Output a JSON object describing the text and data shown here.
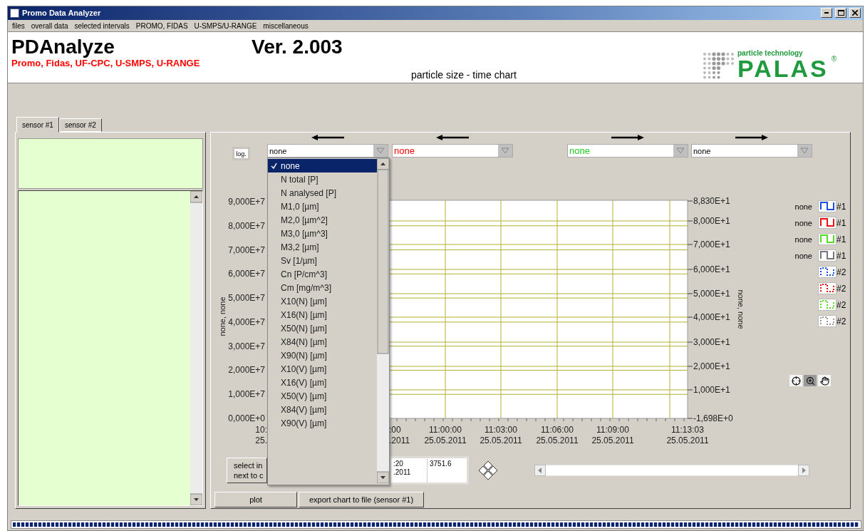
{
  "window": {
    "title": "Promo Data Analyzer"
  },
  "menu": [
    "files",
    "overall data",
    "selected intervals",
    "PROMO, FIDAS",
    "U-SMPS/U-RANGE",
    "miscellaneous"
  ],
  "header": {
    "app_name": "PDAnalyze",
    "devices": "Promo, Fidas, UF-CPC, U-SMPS, U-RANGE",
    "version": "Ver. 2.003",
    "chart_title": "particle size - time chart",
    "logo_tagline": "particle technology",
    "logo_name": "PALAS",
    "logo_mark": "®"
  },
  "tabs": [
    {
      "label": "sensor #1",
      "selected": true
    },
    {
      "label": "sensor #2",
      "selected": false
    }
  ],
  "log_button": "log.",
  "selectors": [
    {
      "value": "none",
      "color": "#000000",
      "kind": "left"
    },
    {
      "value": "none",
      "color": "#ff0000",
      "kind": "left"
    },
    {
      "value": "none",
      "color": "#22cc22",
      "kind": "right"
    },
    {
      "value": "none",
      "color": "#000000",
      "kind": "right"
    }
  ],
  "dropdown": {
    "items": [
      {
        "label": "none",
        "selected": true
      },
      {
        "label": "N total [P]",
        "selected": false
      },
      {
        "label": "N analysed [P]",
        "selected": false
      },
      {
        "label": "M1,0 [µm]",
        "selected": false
      },
      {
        "label": "M2,0 [µm^2]",
        "selected": false
      },
      {
        "label": "M3,0 [µm^3]",
        "selected": false
      },
      {
        "label": "M3,2 [µm]",
        "selected": false
      },
      {
        "label": "Sv [1/µm]",
        "selected": false
      },
      {
        "label": "Cn [P/cm^3]",
        "selected": false
      },
      {
        "label": "Cm [mg/m^3]",
        "selected": false
      },
      {
        "label": "X10(N) [µm]",
        "selected": false
      },
      {
        "label": "X16(N) [µm]",
        "selected": false
      },
      {
        "label": "X50(N) [µm]",
        "selected": false
      },
      {
        "label": "X84(N) [µm]",
        "selected": false
      },
      {
        "label": "X90(N) [µm]",
        "selected": false
      },
      {
        "label": "X10(V) [µm]",
        "selected": false
      },
      {
        "label": "X16(V) [µm]",
        "selected": false
      },
      {
        "label": "X50(V) [µm]",
        "selected": false
      },
      {
        "label": "X84(V) [µm]",
        "selected": false
      },
      {
        "label": "X90(V) [µm]",
        "selected": false
      }
    ]
  },
  "chart": {
    "y_left_title": "none, none",
    "y_right_title": "none, none",
    "y_left_ticks": [
      "9,000E+7",
      "8,000E+7",
      "7,000E+7",
      "6,000E+7",
      "5,000E+7",
      "4,000E+7",
      "3,000E+7",
      "2,000E+7",
      "1,000E+7",
      "0,000E+0"
    ],
    "y_right_ticks": [
      "8,830E+1",
      "8,000E+1",
      "7,000E+1",
      "6,000E+1",
      "5,000E+1",
      "4,000E+1",
      "3,000E+1",
      "2,000E+1",
      "1,000E+1",
      "-1,698E+0"
    ],
    "x_ticks": [
      {
        "time": "10:",
        "date": "25."
      },
      {
        "time": ":00",
        "date": ".2011"
      },
      {
        "time": "11:00:00",
        "date": "25.05.2011"
      },
      {
        "time": "11:03:00",
        "date": "25.05.2011"
      },
      {
        "time": "11:06:00",
        "date": "25.05.2011"
      },
      {
        "time": "11:09:00",
        "date": "25.05.2011"
      },
      {
        "time": "11:13:03",
        "date": "25.05.2011"
      }
    ]
  },
  "legend": [
    {
      "label": "none",
      "sensor": "#1",
      "color": "#1a4fe0",
      "kind": "solid"
    },
    {
      "label": "none",
      "sensor": "#1",
      "color": "#ee1111",
      "kind": "solid"
    },
    {
      "label": "none",
      "sensor": "#1",
      "color": "#55dd22",
      "kind": "solid"
    },
    {
      "label": "none",
      "sensor": "#1",
      "color": "#777777",
      "kind": "solid"
    },
    {
      "sensor": "#2",
      "color": "#1a4fe0",
      "kind": "dotted"
    },
    {
      "sensor": "#2",
      "color": "#ee1111",
      "kind": "dotted"
    },
    {
      "sensor": "#2",
      "color": "#55dd22",
      "kind": "dotted"
    },
    {
      "sensor": "#2",
      "color": "#999999",
      "kind": "dotted"
    }
  ],
  "select_button": [
    "select in",
    "next to c"
  ],
  "readout": {
    "time": ":20",
    "date": ".2011",
    "value": "3751.6"
  },
  "buttons": [
    "plot",
    "export chart to file (sensor #1)"
  ],
  "progress": {
    "level": 1
  }
}
